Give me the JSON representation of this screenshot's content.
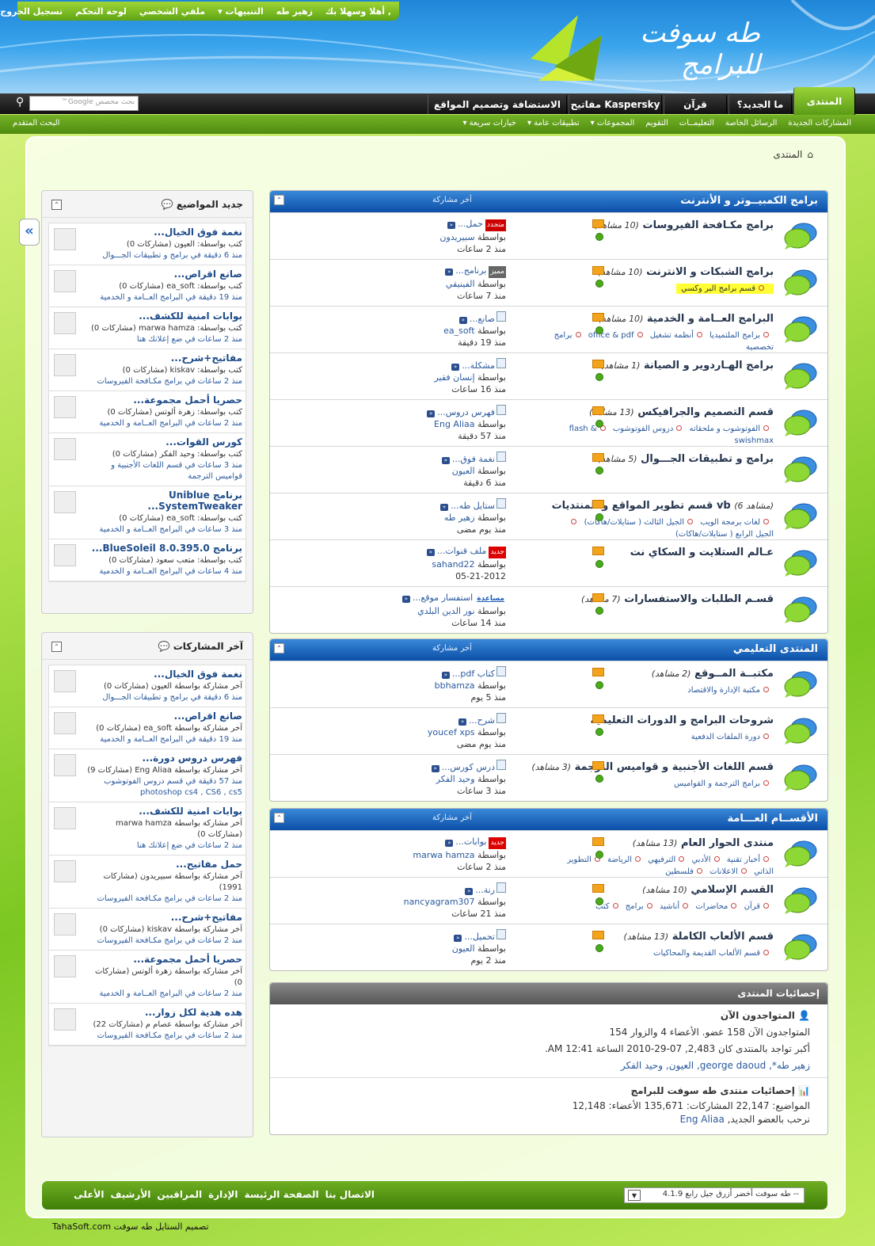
{
  "toplinks": {
    "greeting": "أهلا وسهلا بك ,",
    "user": "زهير طه",
    "notifications": "التنبيهات",
    "profile": "ملفي الشخصي",
    "cp": "لوحة التحكم",
    "logout": "تسجيل الخروج"
  },
  "logo": {
    "text": "طه سوفت للبرامج"
  },
  "nav": {
    "tabs": [
      "المنتدى",
      "ما الجديد؟",
      "قرآن",
      "مفاتيح Kaspersky",
      "الاستضافة وتصميم المواقع"
    ],
    "search_placeholder": "بحث مخصص Google™",
    "advanced": "البحث المتقدم"
  },
  "subnav": [
    "المشاركات الجديدة",
    "الرسائل الخاصة",
    "التعليمــات",
    "التقويم",
    "المجموعات",
    "تطبيقات عامة",
    "خيارات سريعة"
  ],
  "breadcrumb": "المنتدى",
  "last_post_label": "آخر مشاركة",
  "categories": [
    {
      "title": "برامج الكمبيــوتر و الأنترنت",
      "forums": [
        {
          "name": "برامج مكـافحة الفيروسات",
          "views": "(10 مشاهد)",
          "subs": [],
          "lp_title": "حمل...",
          "lp_badge": "متجدد",
          "lp_by": "بواسطة",
          "lp_user": "سبيريدون",
          "lp_ago": "منذ 2 ساعات"
        },
        {
          "name": "برامج الشبكات و الانترنت",
          "views": "(10 مشاهد)",
          "subs": [
            "قسم برامج البر وكسي"
          ],
          "lp_title": "برنامج...",
          "lp_badge": "مميز",
          "lp_by": "بواسطة",
          "lp_user": "الفينيقي",
          "lp_ago": "منذ 7 ساعات"
        },
        {
          "name": "البرامج العــامة و الخدمية",
          "views": "(10 مشاهد)",
          "subs": [
            "برامج الملتميديا",
            "أنظمة تشغيل",
            "office & pdf",
            "برامج تخصصية"
          ],
          "lp_title": "صانع...",
          "lp_badge": "",
          "lp_by": "بواسطة",
          "lp_user": "ea_soft",
          "lp_ago": "منذ 19 دقيقة"
        },
        {
          "name": "برامج الهـاردوير و الصيانة",
          "views": "(1 مشاهد)",
          "subs": [],
          "lp_title": "مشكلة...",
          "lp_badge": "",
          "lp_by": "بواسطة",
          "lp_user": "إنسان فقير",
          "lp_ago": "منذ 16 ساعات"
        },
        {
          "name": "قسم التصميم والجرافيكس",
          "views": "(13 مشاهد)",
          "subs": [
            "الفوتوشوب و ملحقاته",
            "دروس الفوتوشوب",
            "flash & swishmax"
          ],
          "lp_title": "فهرس دروس...",
          "lp_badge": "",
          "lp_by": "بواسطة",
          "lp_user": "Eng Aliaa",
          "lp_ago": "منذ 57 دقيقة"
        },
        {
          "name": "برامج و تطبيقات الجـــوال",
          "views": "(5 مشاهد)",
          "subs": [],
          "lp_title": "نغمة فوق...",
          "lp_badge": "",
          "lp_by": "بواسطة",
          "lp_user": "العيون",
          "lp_ago": "منذ 6 دقيقة"
        },
        {
          "name": "قسم تطوير المواقع و المنتديات vb",
          "views": "(6 مشاهد)",
          "subs": [
            "لغات برمجة الويب",
            "الجيل الثالث ( ستايلات/هاكات)",
            "الجيل الرابع ( ستايلات/هاكات)"
          ],
          "lp_title": "ستايل طه...",
          "lp_badge": "",
          "lp_by": "بواسطة",
          "lp_user": "زهير طه",
          "lp_ago": "منذ يوم مضى"
        },
        {
          "name": "عـالم الستلايت و السكاي نت",
          "views": "",
          "subs": [],
          "lp_title": "ملف قنوات...",
          "lp_badge": "جديد",
          "lp_by": "بواسطة",
          "lp_user": "sahand22",
          "lp_ago": "05-21-2012"
        },
        {
          "name": "قسـم الطلبات والاستفسارات",
          "views": "(7 مشاهد)",
          "subs": [],
          "lp_title": "استفسار موقع...",
          "lp_badge": "مساعدة",
          "lp_by": "بواسطة",
          "lp_user": "نور الدين البلدي",
          "lp_ago": "منذ 14 ساعات"
        }
      ]
    },
    {
      "title": "المنتدى التعليمي",
      "forums": [
        {
          "name": "مكتبــة المــوقع",
          "views": "(2 مشاهد)",
          "subs": [
            "مكتبة الإدارة والاقتصاد"
          ],
          "lp_title": "كتاب pdf...",
          "lp_badge": "",
          "lp_by": "بواسطة",
          "lp_user": "bbhamza",
          "lp_ago": "منذ 5 يوم"
        },
        {
          "name": "شروحات البرامج و الدورات التعليمية",
          "views": "",
          "subs": [
            "دورة الملفات الدفعية"
          ],
          "lp_title": "شرح...",
          "lp_badge": "",
          "lp_by": "بواسطة",
          "lp_user": "youcef xps",
          "lp_ago": "منذ يوم مضى"
        },
        {
          "name": "قسم اللغات الأجنبية و قواميس الترجمة",
          "views": "(3 مشاهد)",
          "subs": [
            "برامج الترجمة و القواميس"
          ],
          "lp_title": "درس كورس...",
          "lp_badge": "",
          "lp_by": "بواسطة",
          "lp_user": "وحيد الفكر",
          "lp_ago": "منذ 3 ساعات"
        }
      ]
    },
    {
      "title": "الأقســام العـــامة",
      "forums": [
        {
          "name": "منتدى الحوار العام",
          "views": "(13 مشاهد)",
          "subs": [
            "أخبار تقنية",
            "الأدبي",
            "الترفيهي",
            "الرياضة",
            "التطوير الذاتي",
            "الاعلانات",
            "فلسطين"
          ],
          "lp_title": "بوابات...",
          "lp_badge": "جديد",
          "lp_by": "بواسطة",
          "lp_user": "marwa hamza",
          "lp_ago": "منذ 2 ساعات"
        },
        {
          "name": "القسم الإسلامي",
          "views": "(10 مشاهد)",
          "subs": [
            "قرآن",
            "محاضرات",
            "أناشيد",
            "برامج",
            "كتب"
          ],
          "lp_title": "رنة...",
          "lp_badge": "",
          "lp_by": "بواسطة",
          "lp_user": "nancyagram307",
          "lp_ago": "منذ 21 ساعات"
        },
        {
          "name": "قسم الألعاب الكاملة",
          "views": "(13 مشاهد)",
          "subs": [
            "قسم الألعاب القديمة والمحاكيات"
          ],
          "lp_title": "تحميل...",
          "lp_badge": "",
          "lp_by": "بواسطة",
          "lp_user": "العيون",
          "lp_ago": "منذ 2 يوم"
        }
      ]
    }
  ],
  "sidebar_new": {
    "title": "جديد المواضيع",
    "items": [
      {
        "title": "نغمة فوق الخيال...",
        "line1": "كتب بواسطة: العيون (مشاركات 0)",
        "line2": "منذ 6 دقيقة في برامج و تطبيقات الجـــوال"
      },
      {
        "title": "صانع اقراص...",
        "line1": "كتب بواسطة: ea_soft (مشاركات 0)",
        "line2": "منذ 19 دقيقة في البرامج العــامة و الخدمية"
      },
      {
        "title": "بوابات امنية للكشف...",
        "line1": "كتب بواسطة: marwa hamza (مشاركات 0)",
        "line2": "منذ 2 ساعات في ضع إعلانك هنا"
      },
      {
        "title": "مفاتيح+شرح...",
        "line1": "كتب بواسطة: kiskav (مشاركات 0)",
        "line2": "منذ 2 ساعات في برامج مكـافحة الفيروسات"
      },
      {
        "title": "حصريا أحمل مجموعة...",
        "line1": "كتب بواسطة: زهرة ألوتس (مشاركات 0)",
        "line2": "منذ 2 ساعات في البرامج العــامة و الخدمية"
      },
      {
        "title": "كورس القوات...",
        "line1": "كتب بواسطة: وحيد الفكر (مشاركات 0)",
        "line2": "منذ 3 ساعات في قسم اللغات الأجنبية و قواميس الترجمة"
      },
      {
        "title": "برنامج Uniblue SystemTweaker...",
        "line1": "كتب بواسطة: ea_soft (مشاركات 0)",
        "line2": "منذ 3 ساعات في البرامج العــامة و الخدمية"
      },
      {
        "title": "برنامج BlueSoleil 8.0.395.0...",
        "line1": "كتب بواسطة: متعب سعود (مشاركات 0)",
        "line2": "منذ 4 ساعات في البرامج العــامة و الخدمية"
      }
    ]
  },
  "sidebar_last": {
    "title": "آخر المشاركات",
    "items": [
      {
        "title": "نغمة فوق الخيال...",
        "line1": "آخر مشاركة بواسطة العيون (مشاركات 0)",
        "line2": "منذ 6 دقيقة في برامج و تطبيقات الجـــوال"
      },
      {
        "title": "صانع اقراص...",
        "line1": "آخر مشاركة بواسطة ea_soft (مشاركات 0)",
        "line2": "منذ 19 دقيقة في البرامج العــامة و الخدمية"
      },
      {
        "title": "فهرس دروس دورة...",
        "line1": "آخر مشاركة بواسطة Eng Aliaa (مشاركات 9)",
        "line2": "منذ 57 دقيقة في قسم دروس الفوتوشوب photoshop cs4 , CS6 , cs5"
      },
      {
        "title": "بوابات امنية للكشف...",
        "line1": "آخر مشاركة بواسطة marwa hamza (مشاركات 0)",
        "line2": "منذ 2 ساعات في ضع إعلانك هنا"
      },
      {
        "title": "حمل مفاتيح...",
        "line1": "آخر مشاركة بواسطة سبيريدون (مشاركات 1991)",
        "line2": "منذ 2 ساعات في برامج مكـافحة الفيروسات"
      },
      {
        "title": "مفاتيح+شرح...",
        "line1": "آخر مشاركة بواسطة kiskav (مشاركات 0)",
        "line2": "منذ 2 ساعات في برامج مكـافحة الفيروسات"
      },
      {
        "title": "حصريا أحمل مجموعة...",
        "line1": "آخر مشاركة بواسطة زهرة ألوتس (مشاركات 0)",
        "line2": "منذ 2 ساعات في البرامج العــامة و الخدمية"
      },
      {
        "title": "هده هدية لكل زوار...",
        "line1": "آخر مشاركة بواسطة عصام م (مشاركات 22)",
        "line2": "منذ 2 ساعات في برامج مكـافحة الفيروسات"
      }
    ]
  },
  "stats": {
    "title": "إحصائيات المنتدى",
    "online_title": "المتواجدون الآن",
    "online_line": "المتواجدون الآن 158 عضو. الأعضاء 4 والزوار 154",
    "max_line": "أكبر تواجد بالمنتدى كان 2,483, 07-29-2010 الساعة 12:41 AM.",
    "users": "زهير طه*, george daoud, العيون, وحيد الفكر",
    "forum_stats_title": "إحصائيات منتدى طه سوفت للبرامج",
    "counts": "المواضيع: 22,147 المشاركات: 135,671 الأعضاء: 12,148",
    "welcome": "نرحب بالعضو الجديد,",
    "new_member": "Eng Aliaa"
  },
  "footer": {
    "links": [
      "الاتصال بنا",
      "الصفحة الرئيسة",
      "الإدارة",
      "المراقبين",
      "الأرشيف",
      "الأعلى"
    ],
    "style_select": "-- طه سوفت أخضر أزرق جيل رابع 4.1.9"
  },
  "credit": "تصميم الستايل طه سوفت TahaSoft.com"
}
